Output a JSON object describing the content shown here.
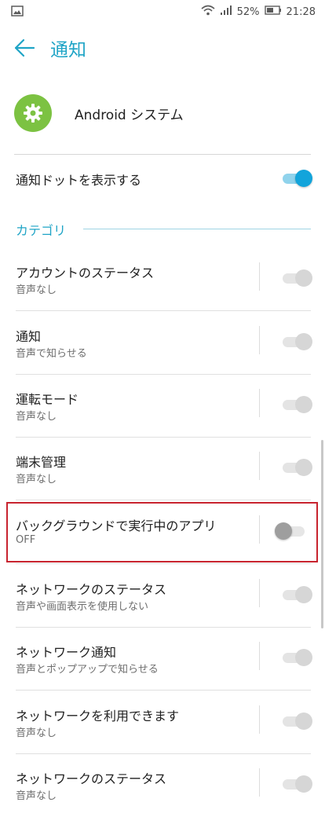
{
  "status": {
    "battery": "52%",
    "time": "21:28"
  },
  "header": {
    "title": "通知"
  },
  "app": {
    "name": "Android システム",
    "icon": "gear-icon",
    "icon_color": "#7cc242"
  },
  "dots": {
    "label": "通知ドットを表示する",
    "enabled": true
  },
  "category_header": "カテゴリ",
  "categories": [
    {
      "title": "アカウントのステータス",
      "subtitle": "音声なし",
      "state": "disabled-on"
    },
    {
      "title": "通知",
      "subtitle": "音声で知らせる",
      "state": "disabled-on"
    },
    {
      "title": "運転モード",
      "subtitle": "音声なし",
      "state": "disabled-on"
    },
    {
      "title": "端末管理",
      "subtitle": "音声なし",
      "state": "disabled-on"
    },
    {
      "title": "バックグラウンドで実行中のアプリ",
      "subtitle": "OFF",
      "state": "off",
      "highlighted": true
    },
    {
      "title": "ネットワークのステータス",
      "subtitle": "音声や画面表示を使用しない",
      "state": "disabled-on"
    },
    {
      "title": "ネットワーク通知",
      "subtitle": "音声とポップアップで知らせる",
      "state": "disabled-on"
    },
    {
      "title": "ネットワークを利用できます",
      "subtitle": "音声なし",
      "state": "disabled-on"
    },
    {
      "title": "ネットワークのステータス",
      "subtitle": "音声なし",
      "state": "disabled-on"
    }
  ],
  "colors": {
    "accent": "#1fa4c6",
    "toggle_on": "#12a4db",
    "highlight_border": "#c8242f"
  }
}
